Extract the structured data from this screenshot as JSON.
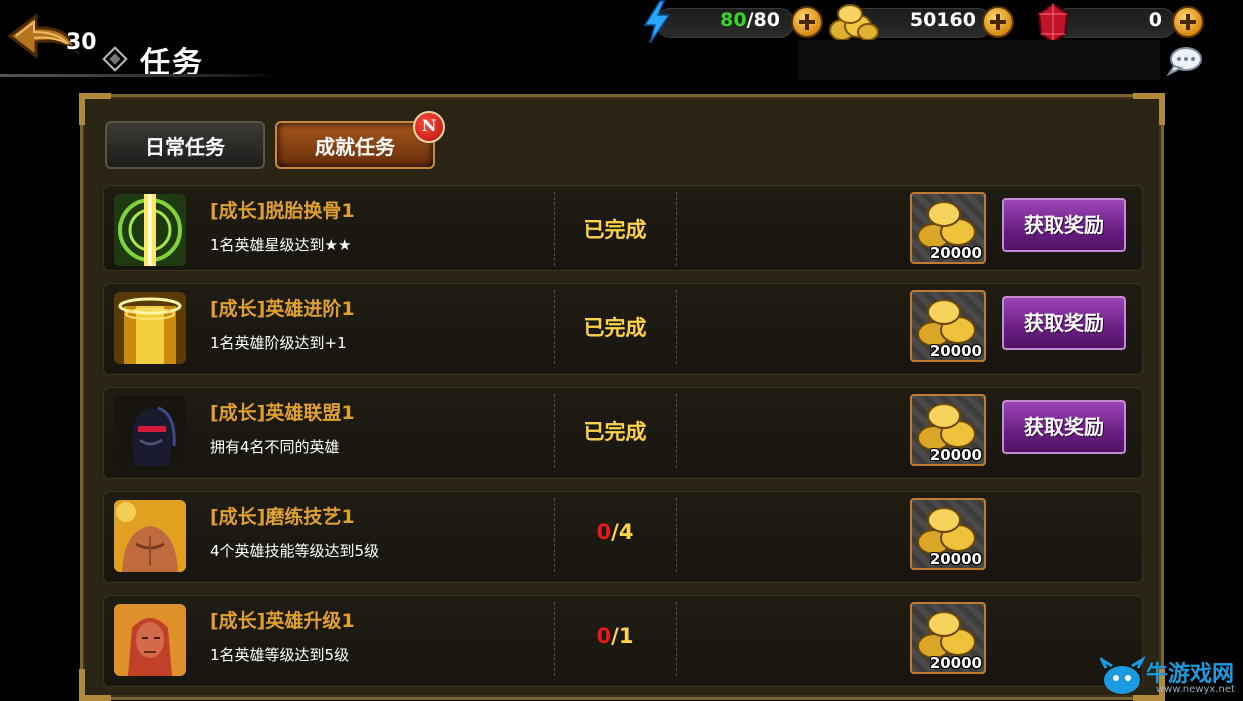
{
  "header": {
    "level": "30",
    "title": "任务"
  },
  "resources": {
    "energy_current": "80",
    "energy_sep_max": "/80",
    "gold": "50160",
    "gems": "0"
  },
  "tabs": [
    {
      "label": "日常任务",
      "active": false
    },
    {
      "label": "成就任务",
      "active": true,
      "badge": "N"
    }
  ],
  "tasks": [
    {
      "title": "[成长]脱胎换骨1",
      "desc": "1名英雄星级达到★★",
      "status": "已完成",
      "reward": "20000",
      "claim": "获取奖励",
      "icon": "golden-light-icon"
    },
    {
      "title": "[成长]英雄进阶1",
      "desc": "1名英雄阶级达到+1",
      "status": "已完成",
      "reward": "20000",
      "claim": "获取奖励",
      "icon": "golden-halo-icon"
    },
    {
      "title": "[成长]英雄联盟1",
      "desc": "拥有4名不同的英雄",
      "status": "已完成",
      "reward": "20000",
      "claim": "获取奖励",
      "icon": "ninja-hero-icon"
    },
    {
      "title": "[成长]磨练技艺1",
      "desc": "4个英雄技能等级达到5级",
      "progress_current": "0",
      "progress_total": "/4",
      "reward": "20000",
      "icon": "muscle-hero-icon"
    },
    {
      "title": "[成长]英雄升级1",
      "desc": "1名英雄等级达到5级",
      "progress_current": "0",
      "progress_total": "/1",
      "reward": "20000",
      "icon": "red-hero-icon"
    }
  ],
  "watermark": {
    "text": "牛游戏网",
    "url": "www.newyx.net"
  },
  "colors": {
    "title_gold": "#e0a030",
    "status_yellow": "#ffd24a",
    "progress_red": "#e21a1a",
    "claim_purple": "#7a2a94",
    "energy_green": "#39d42a"
  }
}
